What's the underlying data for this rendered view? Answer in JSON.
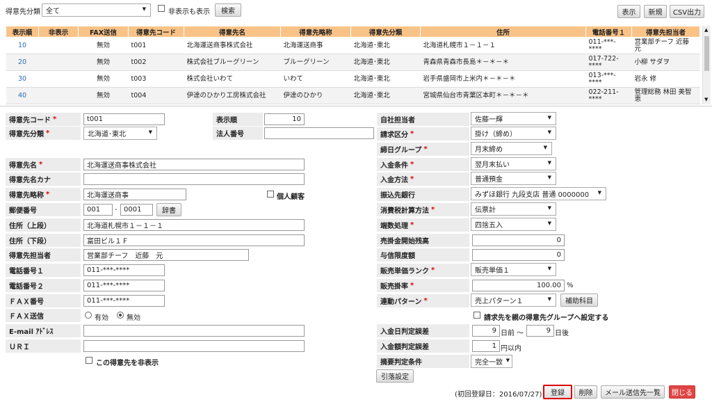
{
  "toolbar": {
    "category_label": "得意先分類",
    "category_value": "全て",
    "show_hidden_label": "非表示も表示",
    "search_label": "検索",
    "display_label": "表示",
    "new_label": "新規",
    "csv_label": "CSV出力"
  },
  "grid": {
    "headers": [
      "表示順",
      "非表示",
      "FAX送信",
      "得意先コード",
      "得意先名",
      "得意先略称",
      "得意先分類",
      "住所",
      "電話番号１",
      "得意先担当者"
    ],
    "rows": [
      {
        "order": "10",
        "hidden": "",
        "fax": "無効",
        "code": "t001",
        "name": "北海運送商事株式会社",
        "short": "北海運送商事",
        "category": "北海道･東北",
        "address": "北海道札幌市１－１－１",
        "tel": "011-***-****",
        "person": "営業部チーフ 近藤 元"
      },
      {
        "order": "20",
        "hidden": "",
        "fax": "無効",
        "code": "t002",
        "name": "株式会社ブルーグリーン",
        "short": "ブルーグリーン",
        "category": "北海道･東北",
        "address": "青森県青森市長島＊－＊－＊",
        "tel": "017-722-****",
        "person": "小柳 サダヲ"
      },
      {
        "order": "30",
        "hidden": "",
        "fax": "無効",
        "code": "t003",
        "name": "株式会社いわて",
        "short": "いわて",
        "category": "北海道･東北",
        "address": "岩手県盛岡市上米内＊－＊－＊",
        "tel": "013-***-****",
        "person": "岩永 修"
      },
      {
        "order": "40",
        "hidden": "",
        "fax": "無効",
        "code": "t004",
        "name": "伊達のひかり工房株式会社",
        "short": "伊達のひかり",
        "category": "北海道･東北",
        "address": "宮城県仙台市青葉区本町＊－＊－＊",
        "tel": "022-211-****",
        "person": "管理総務 林田 美智恵"
      }
    ]
  },
  "form": {
    "code_label": "得意先コード",
    "code_value": "t001",
    "order_label": "表示順",
    "order_value": "10",
    "category_label": "得意先分類",
    "category_value": "北海道･東北",
    "corp_no_label": "法人番号",
    "corp_no_value": "",
    "name_label": "得意先名",
    "name_value": "北海運送商事株式会社",
    "kana_label": "得意先名カナ",
    "kana_value": "",
    "short_label": "得意先略称",
    "short_value": "北海運送商事",
    "individual_label": "個人顧客",
    "zip_label": "郵便番号",
    "zip1": "001",
    "zip_sep": "-",
    "zip2": "0001",
    "dict_label": "辞書",
    "addr1_label": "住所（上段）",
    "addr1_value": "北海道札幌市１－１－１",
    "addr2_label": "住所（下段）",
    "addr2_value": "富田ビル１Ｆ",
    "person_label": "得意先担当者",
    "person_value": "営業部チーフ　近藤　元",
    "tel1_label": "電話番号１",
    "tel1_value": "011-***-****",
    "tel2_label": "電話番号２",
    "tel2_value": "011-***-****",
    "fax_label": "ＦＡＸ番号",
    "fax_value": "011-***-****",
    "faxsend_label": "ＦＡＸ送信",
    "fax_on": "有効",
    "fax_off": "無効",
    "email_label": "E-mail ｱﾄﾞﾚｽ",
    "email_value": "",
    "uri_label": "ＵＲＩ",
    "uri_value": "",
    "hide_label": "この得意先を非表示",
    "staff_label": "自社担当者",
    "staff_value": "佐藤一輝",
    "billing_label": "請求区分",
    "billing_value": "掛け（締め）",
    "closing_label": "締日グループ",
    "closing_value": "月末締め",
    "payterm_label": "入金条件",
    "payterm_value": "翌月末払い",
    "paymethod_label": "入金方法",
    "paymethod_value": "普通預金",
    "bank_label": "振込先銀行",
    "bank_value": "みずほ銀行 九段支店 普通 0000000",
    "tax_label": "消費税計算方法",
    "tax_value": "伝票計",
    "rounding_label": "端数処理",
    "rounding_value": "四捨五入",
    "ar_label": "売掛金開始残高",
    "ar_value": "0",
    "credit_label": "与信限度額",
    "credit_value": "0",
    "rank_label": "販売単価ランク",
    "rank_value": "販売単価１",
    "rate_label": "販売掛率",
    "rate_value": "100.00",
    "rate_unit": "%",
    "pattern_label": "連動パターン",
    "pattern_value": "売上パターン１",
    "subaccount_label": "補助科目",
    "parent_label": "請求先を親の得意先グループへ設定する",
    "daydiff_label": "入金日判定誤差",
    "daydiff_before": "9",
    "before_unit": "日前 ～",
    "daydiff_after": "9",
    "after_unit": "日後",
    "amtdiff_label": "入金額判定誤差",
    "amtdiff_value": "1",
    "amt_unit": "円以内",
    "summary_label": "摘要判定条件",
    "summary_value": "完全一致",
    "debit_label": "引落設定",
    "first_reg": "(初回登録日：2016/07/27)",
    "register_label": "登録",
    "delete_label": "削除",
    "mail_label": "メール送信先一覧",
    "close_label": "閉じる"
  },
  "colors": {
    "header": "#f9c388",
    "link": "#2a6db5",
    "required": "#dd0000",
    "close_btn": "#e04545"
  }
}
